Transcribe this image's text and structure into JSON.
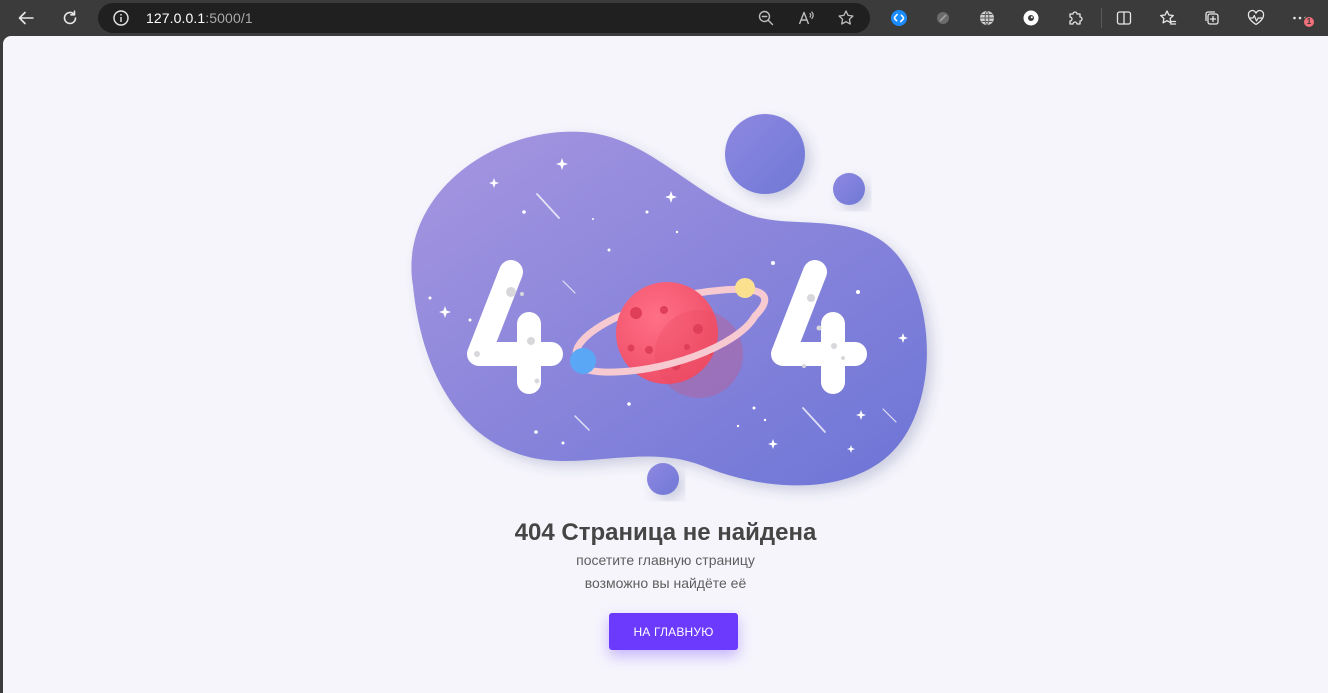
{
  "browser": {
    "address": {
      "host": "127.0.0.1",
      "path": ":5000/1"
    },
    "nav_icons": [
      "back-arrow-icon",
      "refresh-icon",
      "info-icon"
    ],
    "address_actions": [
      "zoom-out-icon",
      "read-aloud-icon",
      "favorite-star-icon"
    ],
    "extension_icons": [
      "shazam-extension-icon",
      "dark-extension-icon",
      "globe-extension-icon",
      "circle-extension-icon",
      "extensions-puzzle-icon"
    ],
    "toolbar_icons": [
      "split-screen-icon",
      "favorites-icon",
      "collections-icon",
      "browser-essentials-icon",
      "more-menu-icon"
    ],
    "notification_badge": "1"
  },
  "page": {
    "illustration": {
      "left_digit": "4",
      "right_digit": "4",
      "blob_gradient": [
        "#a796e0",
        "#6c74d6"
      ],
      "planet_color": "#f45b72",
      "ring_color": "#f7c9d1",
      "moon_colors": [
        "#5aa7f6",
        "#fbe08f"
      ]
    },
    "error": {
      "code": "404",
      "title": "Страница не найдена",
      "line1": "посетите главную страницу",
      "line2": "возможно вы найдёте её"
    },
    "home_button_label": "НА ГЛАВНУЮ",
    "accent_color": "#6c3afc"
  }
}
